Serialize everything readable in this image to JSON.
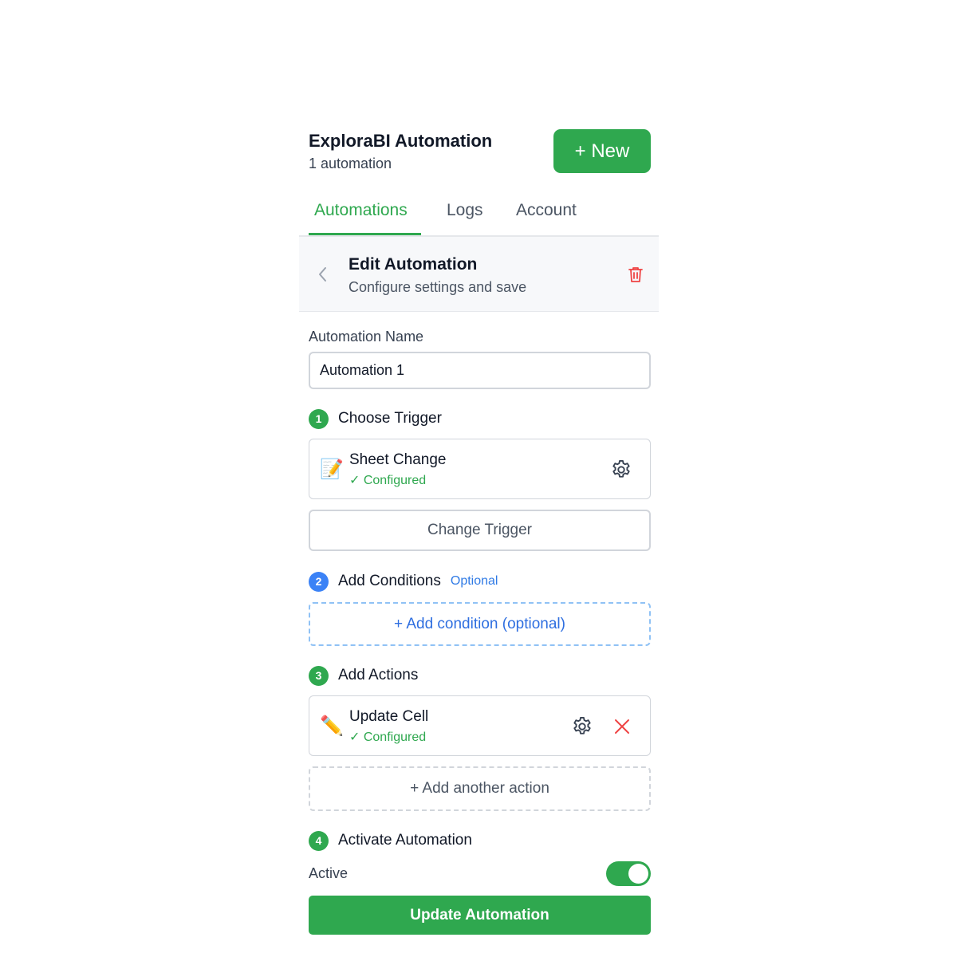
{
  "header": {
    "title": "ExploraBI Automation",
    "subtitle": "1 automation",
    "new_button": "+ New"
  },
  "tabs": [
    {
      "label": "Automations",
      "active": true
    },
    {
      "label": "Logs",
      "active": false
    },
    {
      "label": "Account",
      "active": false
    }
  ],
  "edit": {
    "title": "Edit Automation",
    "subtitle": "Configure settings and save"
  },
  "form": {
    "name_label": "Automation Name",
    "name_value": "Automation 1"
  },
  "steps": {
    "trigger": {
      "number": "1",
      "title": "Choose Trigger",
      "card_icon": "📝",
      "card_title": "Sheet Change",
      "card_status": "✓ Configured",
      "change_button": "Change Trigger"
    },
    "conditions": {
      "number": "2",
      "title": "Add Conditions",
      "badge": "Optional",
      "add_button": "+ Add condition (optional)"
    },
    "actions": {
      "number": "3",
      "title": "Add Actions",
      "card_icon": "✏️",
      "card_title": "Update Cell",
      "card_status": "✓ Configured",
      "add_button": "+ Add another action"
    },
    "activate": {
      "number": "4",
      "title": "Activate Automation",
      "active_label": "Active",
      "active": true
    }
  },
  "submit_button": "Update Automation",
  "colors": {
    "accent": "#2fa84f",
    "info": "#3b82f6",
    "danger": "#ef4444"
  }
}
